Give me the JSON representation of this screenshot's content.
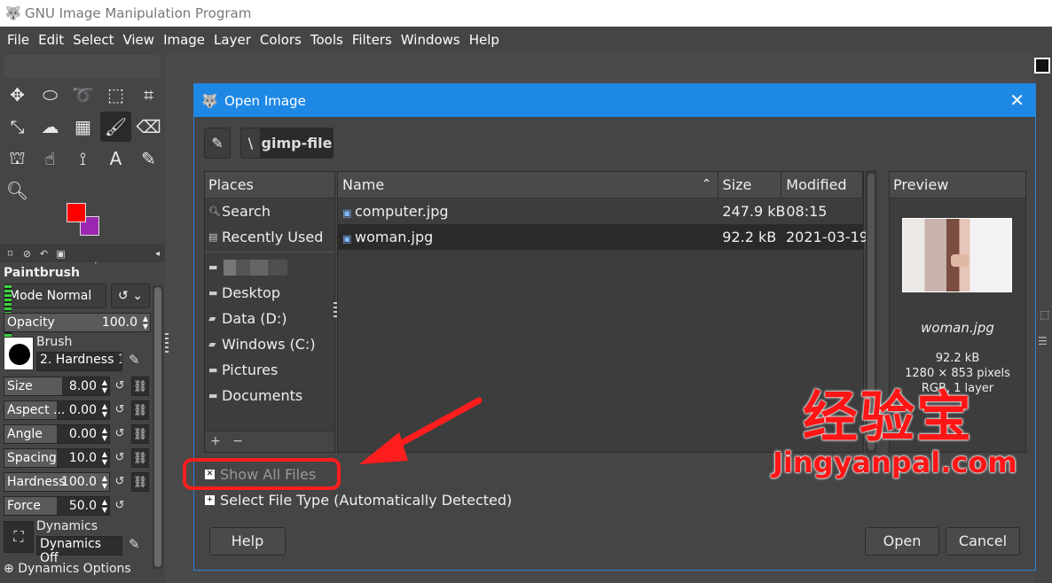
{
  "window": {
    "title": "GNU Image Manipulation Program"
  },
  "menubar": [
    "File",
    "Edit",
    "Select",
    "View",
    "Image",
    "Layer",
    "Colors",
    "Tools",
    "Filters",
    "Windows",
    "Help"
  ],
  "toolbox": {
    "tools": [
      "move-tool",
      "ellipse-select-tool",
      "free-select-tool",
      "fuzzy-select-tool",
      "crop-tool",
      "unified-transform-tool",
      "warp-transform-tool",
      "gradient-tool",
      "paintbrush-tool",
      "eraser-tool",
      "clone-tool",
      "smudge-tool",
      "paths-tool",
      "text-tool",
      "color-picker-tool",
      "zoom-tool"
    ],
    "fg_color": "#ff0000",
    "bg_color": "#9b27b0"
  },
  "tool_options": {
    "title": "Paintbrush",
    "mode_label": "Mode",
    "mode_value": "Normal",
    "opacity": {
      "label": "Opacity",
      "value": "100.0",
      "fill": 1.0
    },
    "brush_label": "Brush",
    "brush_name": "2. Hardness 100",
    "size": {
      "label": "Size",
      "value": "8.00",
      "fill": 0.55
    },
    "aspect": {
      "label": "Aspect ...",
      "value": "0.00",
      "fill": 0.5
    },
    "angle": {
      "label": "Angle",
      "value": "0.00",
      "fill": 0.5
    },
    "spacing": {
      "label": "Spacing",
      "value": "10.0",
      "fill": 0.5
    },
    "hardness": {
      "label": "Hardness",
      "value": "100.0",
      "fill": 1.0
    },
    "force": {
      "label": "Force",
      "value": "50.0",
      "fill": 0.5
    },
    "dynamics_label": "Dynamics",
    "dynamics_name": "Dynamics Off",
    "dynamics_options": "Dynamics Options"
  },
  "dialog": {
    "title": "Open Image",
    "path_sep": "\\",
    "path_folder": "gimp-file",
    "places": {
      "header": "Places",
      "items": [
        {
          "label": "Search",
          "icon": "search-icon"
        },
        {
          "label": "Recently Used",
          "icon": "recent-icon"
        },
        {
          "label": "",
          "icon": "folder-icon",
          "redacted": true
        },
        {
          "label": "Desktop",
          "icon": "folder-icon"
        },
        {
          "label": "Data (D:)",
          "icon": "drive-icon"
        },
        {
          "label": "Windows (C:)",
          "icon": "drive-icon"
        },
        {
          "label": "Pictures",
          "icon": "folder-icon"
        },
        {
          "label": "Documents",
          "icon": "folder-icon"
        }
      ],
      "add": "+",
      "remove": "−"
    },
    "files": {
      "columns": {
        "name": "Name",
        "size": "Size",
        "modified": "Modified"
      },
      "rows": [
        {
          "name": "computer.jpg",
          "size": "247.9 kB",
          "modified": "08:15",
          "selected": false
        },
        {
          "name": "woman.jpg",
          "size": "92.2 kB",
          "modified": "2021-03-19",
          "selected": true
        }
      ]
    },
    "preview": {
      "header": "Preview",
      "name": "woman.jpg",
      "size": "92.2 kB",
      "dims": "1280 × 853 pixels",
      "layers": "RGB, 1 layer"
    },
    "show_all_files": "Show All Files",
    "select_file_type": "Select File Type (Automatically Detected)",
    "help_button": "Help",
    "open_button": "Open",
    "cancel_button": "Cancel"
  },
  "watermark": {
    "cn": "经验宝",
    "en": "Jingyanpal.com"
  },
  "colors": {
    "accent": "#1e88e5",
    "annotation": "#ff1d1d"
  }
}
